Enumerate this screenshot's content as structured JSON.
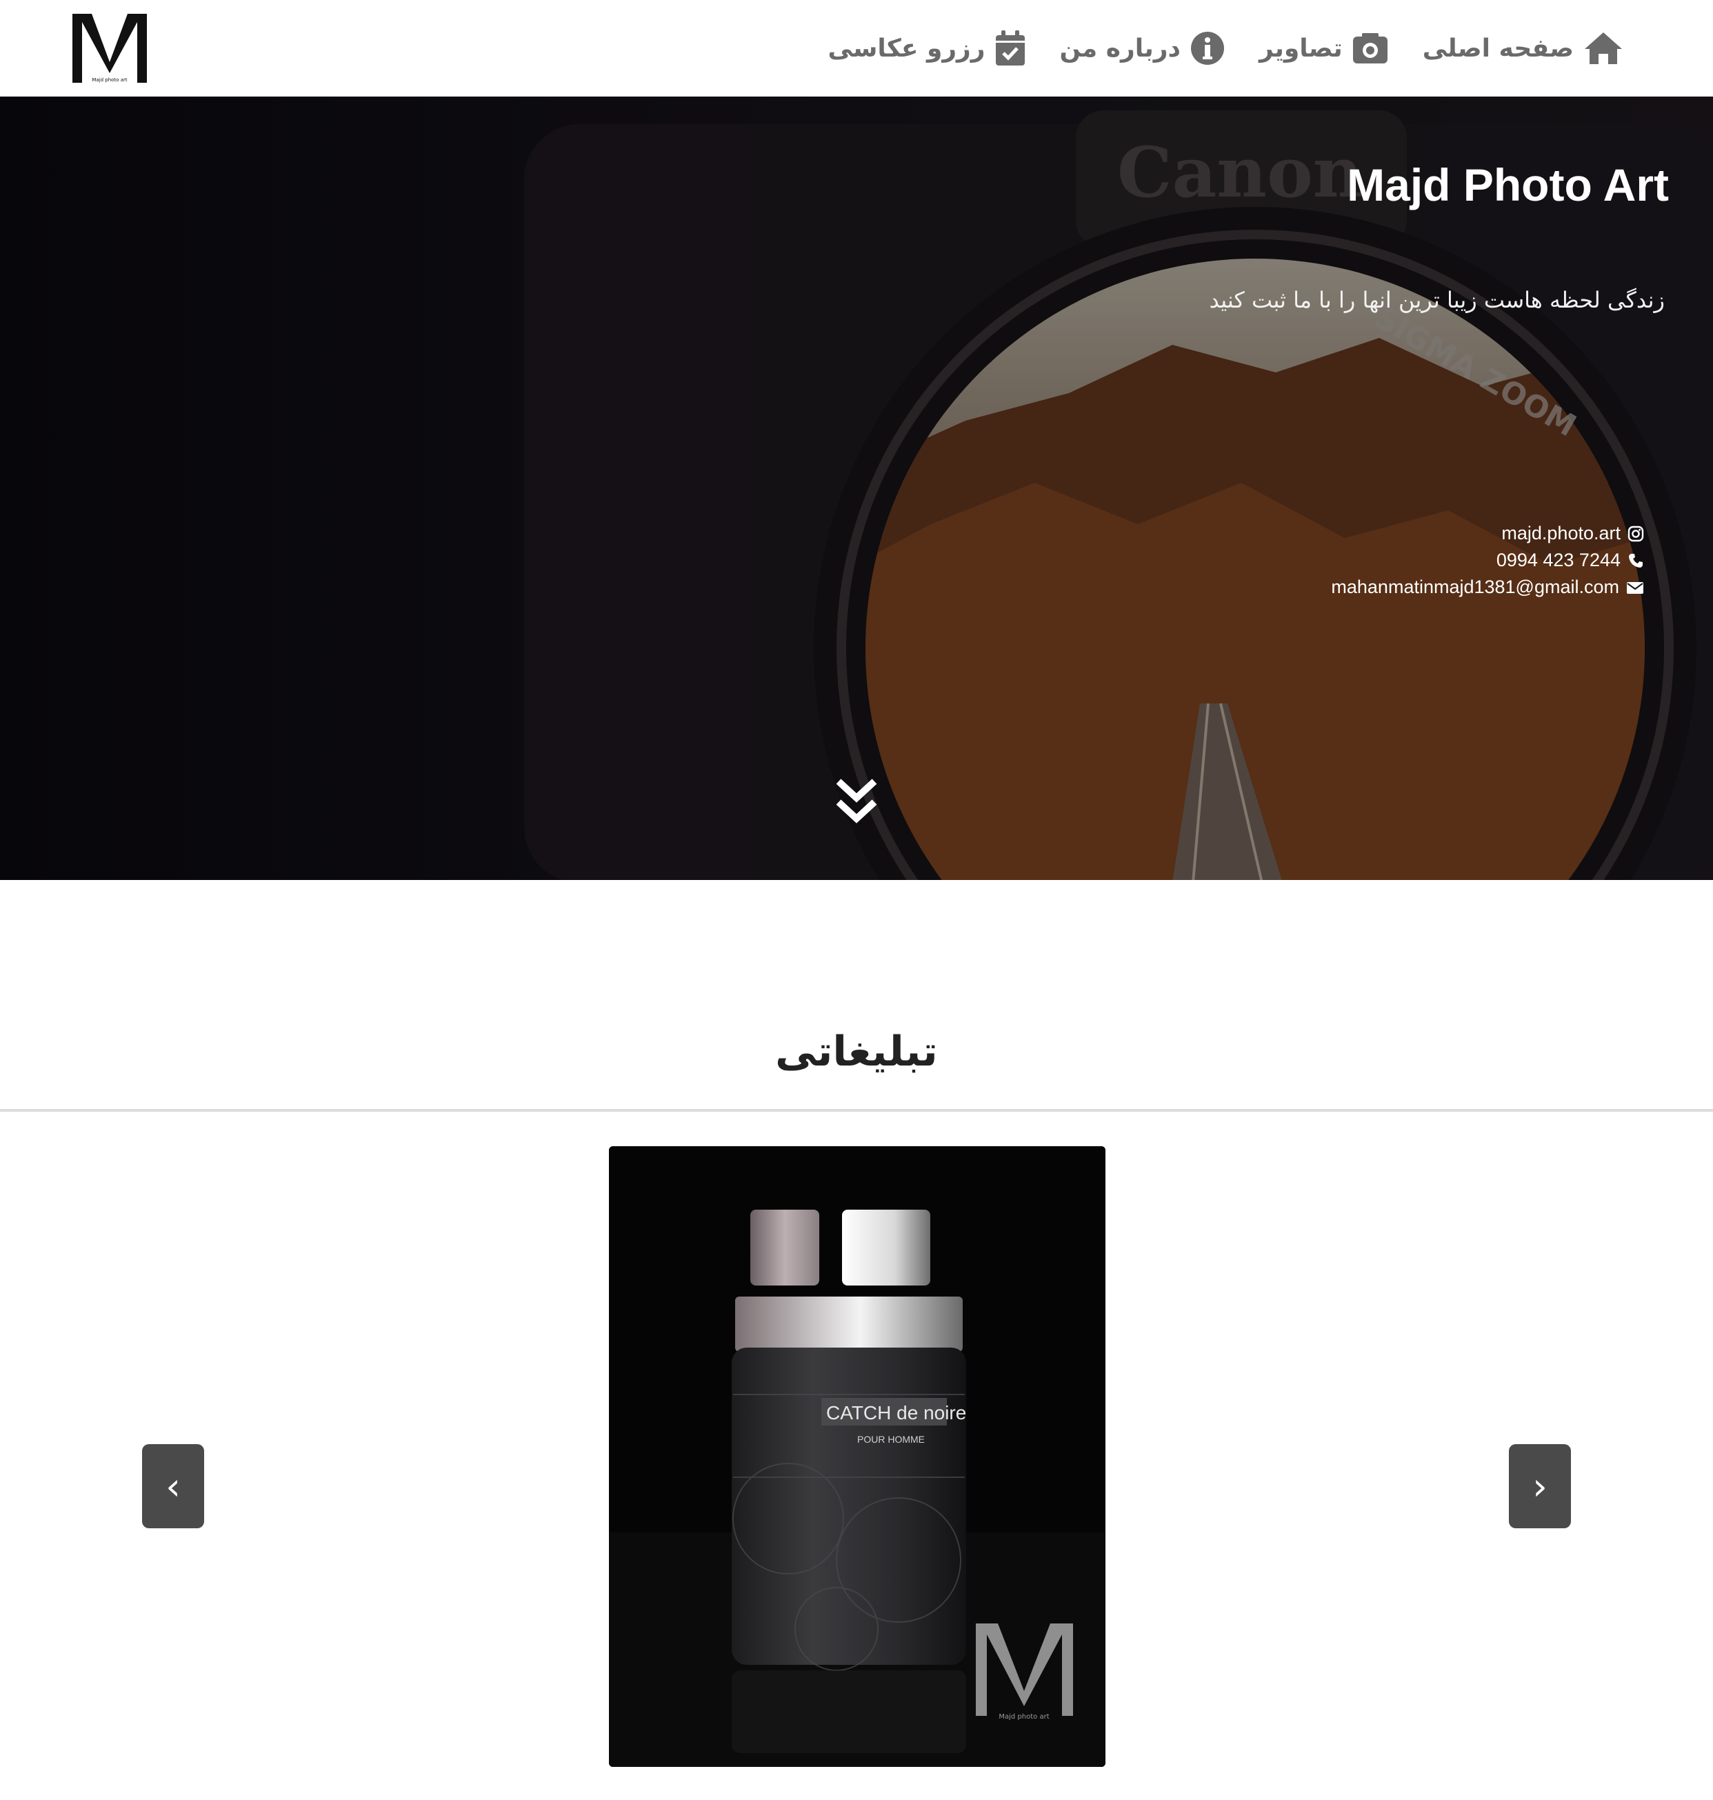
{
  "brand": {
    "logo_caption": "Majd photo art"
  },
  "nav": {
    "items": [
      {
        "label": "صفحه اصلی",
        "icon": "home-icon"
      },
      {
        "label": "تصاویر",
        "icon": "camera-icon"
      },
      {
        "label": "درباره من",
        "icon": "info-circle-icon"
      },
      {
        "label": "رزرو عکاسی",
        "icon": "calendar-check-icon"
      }
    ]
  },
  "hero": {
    "title": "Majd Photo Art",
    "tagline": "زندگی لحظه هاست زیبا ترین انها را با ما ثبت کنید",
    "contacts": {
      "instagram": "majd.photo.art",
      "phone": "0994 423 7244",
      "email": "mahanmatinmajd1381@gmail.com"
    },
    "scroll_icon": "double-chevron-down-icon"
  },
  "section": {
    "title": "تبلیغاتی"
  },
  "carousel": {
    "prev_label": "‹",
    "next_label": "›",
    "slide": {
      "product_name": "CATCH de noire",
      "product_sub": "POUR HOMME",
      "watermark": "Majd photo art"
    }
  },
  "colors": {
    "nav_text": "#6a6a6a",
    "carousel_button": "#4a4a4a",
    "divider": "#dcdcdc"
  }
}
